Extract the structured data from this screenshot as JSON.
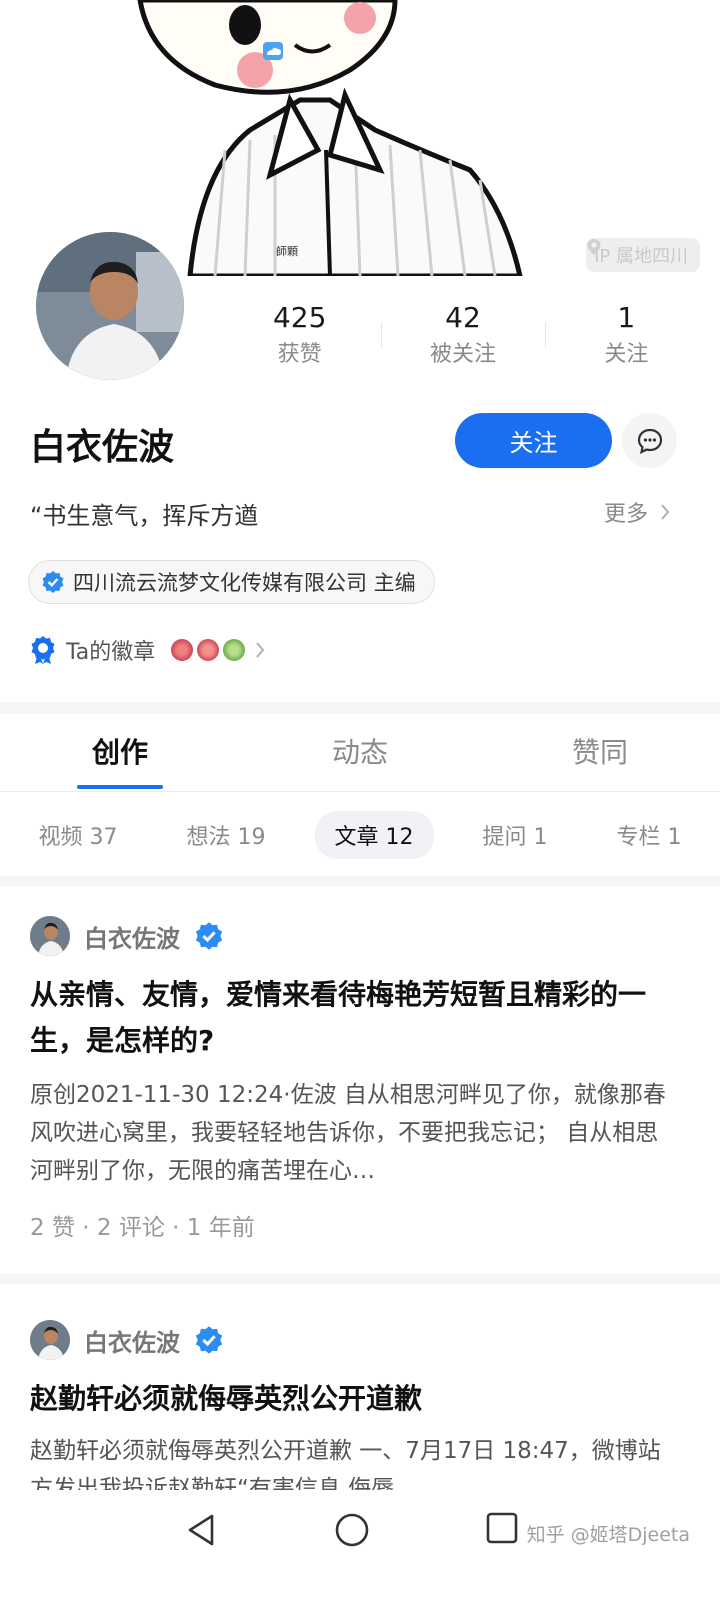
{
  "cover": {
    "ip_location": "IP 属地四川",
    "shirt_tag": "師顆"
  },
  "profile": {
    "name": "白衣佐波",
    "follow_label": "关注",
    "bio": "“书生意气，挥斥方遒",
    "more_label": "更多",
    "org_badge": "四川流云流梦文化传媒有限公司 主编",
    "badges_label": "Ta的徽章"
  },
  "stats": [
    {
      "num": "425",
      "label": "获赞"
    },
    {
      "num": "42",
      "label": "被关注"
    },
    {
      "num": "1",
      "label": "关注"
    }
  ],
  "tabs": [
    {
      "label": "创作",
      "active": true
    },
    {
      "label": "动态",
      "active": false
    },
    {
      "label": "赞同",
      "active": false
    }
  ],
  "subtabs": [
    {
      "label": "视频 37",
      "active": false
    },
    {
      "label": "想法 19",
      "active": false
    },
    {
      "label": "文章 12",
      "active": true
    },
    {
      "label": "提问 1",
      "active": false
    },
    {
      "label": "专栏 1",
      "active": false
    }
  ],
  "articles": [
    {
      "author": "白衣佐波",
      "title": "从亲情、友情，爱情来看待梅艳芳短暂且精彩的一生，是怎样的?",
      "excerpt": "原创2021-11-30 12:24·佐波 自从相思河畔见了你，就像那春风吹进心窝里，我要轻轻地告诉你，不要把我忘记； 自从相思河畔别了你，无限的痛苦埋在心…",
      "meta": "2 赞 · 2 评论 · 1 年前"
    },
    {
      "author": "白衣佐波",
      "title": "赵勤轩必须就侮辱英烈公开道歉",
      "excerpt": "赵勤轩必须就侮辱英烈公开道歉 一、7月17日 18:47，微博站方发出我投诉赵勤轩“有害信息 侮辱"
    }
  ],
  "watermark": "知乎 @姬塔Djeeta",
  "colors": {
    "accent": "#1a6ff0",
    "verified": "#2c8cf4"
  }
}
